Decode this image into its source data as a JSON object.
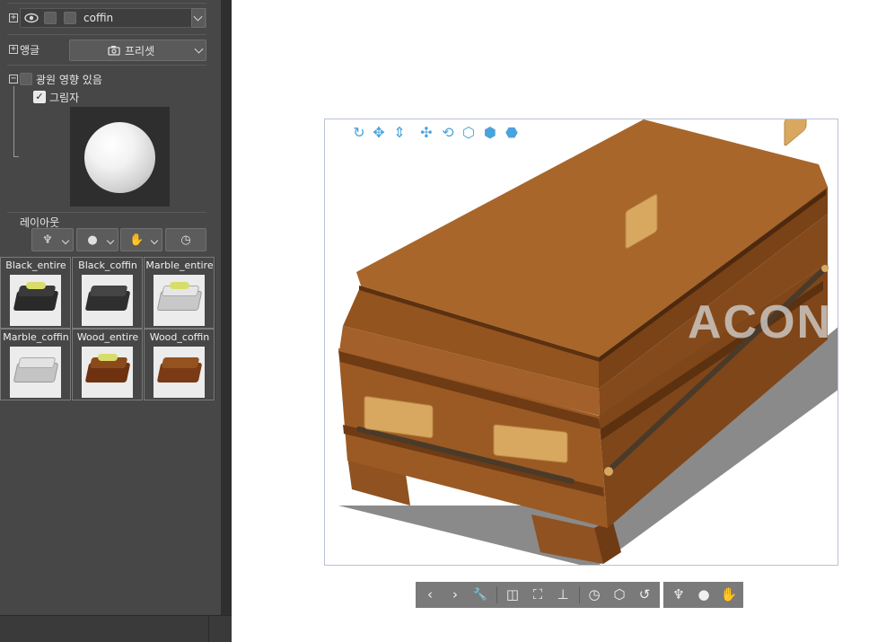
{
  "layer": {
    "name": "coffin",
    "expand_glyph": "+",
    "visibility_icon": "eye-icon"
  },
  "angle": {
    "label": "앵글",
    "expand_glyph": "+",
    "preset_label": "프리셋",
    "preset_icon": "camera-icon"
  },
  "lighting": {
    "collapse_glyph": "−",
    "light_label": "광원 영향 있음",
    "light_checked": false,
    "shadow_label": "그림자",
    "shadow_checked": true,
    "check_glyph": "✓"
  },
  "layout": {
    "label": "레이아웃",
    "buttons": [
      {
        "icon": "pose-icon",
        "glyph": "♆"
      },
      {
        "icon": "head-icon",
        "glyph": "●"
      },
      {
        "icon": "hand-icon",
        "glyph": "✋"
      },
      {
        "icon": "clock-icon",
        "glyph": "◷"
      }
    ]
  },
  "presets": [
    {
      "caption": "Black_entire",
      "color": "#2a2a2a",
      "flowers": true
    },
    {
      "caption": "Black_coffin",
      "color": "#2f2f2f",
      "flowers": false
    },
    {
      "caption": "Marble_entire",
      "color": "#d8d8d8",
      "flowers": true
    },
    {
      "caption": "Marble_coffin",
      "color": "#d2d2d2",
      "flowers": false
    },
    {
      "caption": "Wood_entire",
      "color": "#7a3a12",
      "flowers": true
    },
    {
      "caption": "Wood_coffin",
      "color": "#7e3d16",
      "flowers": false
    }
  ],
  "viewport": {
    "watermark": "ACON",
    "tools": [
      {
        "icon": "camera-rotate-icon",
        "glyph": "↻"
      },
      {
        "icon": "camera-pan-icon",
        "glyph": "✥"
      },
      {
        "icon": "camera-dolly-icon",
        "glyph": "⇕"
      },
      {
        "icon": "object-move-icon",
        "glyph": "✣"
      },
      {
        "icon": "object-rotate-icon",
        "glyph": "⟲"
      },
      {
        "icon": "object-rotate-axis-icon",
        "glyph": "⬡"
      },
      {
        "icon": "object-tilt-icon",
        "glyph": "⬢"
      },
      {
        "icon": "object-scale-icon",
        "glyph": "⬣"
      }
    ],
    "colors": {
      "wood_light": "#a8662a",
      "wood_mid": "#8f5220",
      "wood_dark": "#6e3b14",
      "brass": "#d9a860",
      "shadow": "#8a8a8a"
    }
  },
  "bottom_toolbar": {
    "left": [
      {
        "icon": "previous-icon",
        "glyph": "‹"
      },
      {
        "icon": "next-icon",
        "glyph": "›"
      },
      {
        "icon": "wrench-icon",
        "glyph": "🔧"
      },
      {
        "icon": "camera-settings-icon",
        "glyph": "◫"
      },
      {
        "icon": "fit-view-icon",
        "glyph": "⛶"
      },
      {
        "icon": "ground-icon",
        "glyph": "⊥"
      },
      {
        "icon": "reset-pose-icon",
        "glyph": "◷"
      },
      {
        "icon": "reset-rotation-icon",
        "glyph": "⬡"
      },
      {
        "icon": "reset-all-icon",
        "glyph": "↺"
      }
    ],
    "right": [
      {
        "icon": "pose-icon",
        "glyph": "♆"
      },
      {
        "icon": "head-icon",
        "glyph": "●"
      },
      {
        "icon": "hand-icon",
        "glyph": "✋"
      }
    ]
  }
}
